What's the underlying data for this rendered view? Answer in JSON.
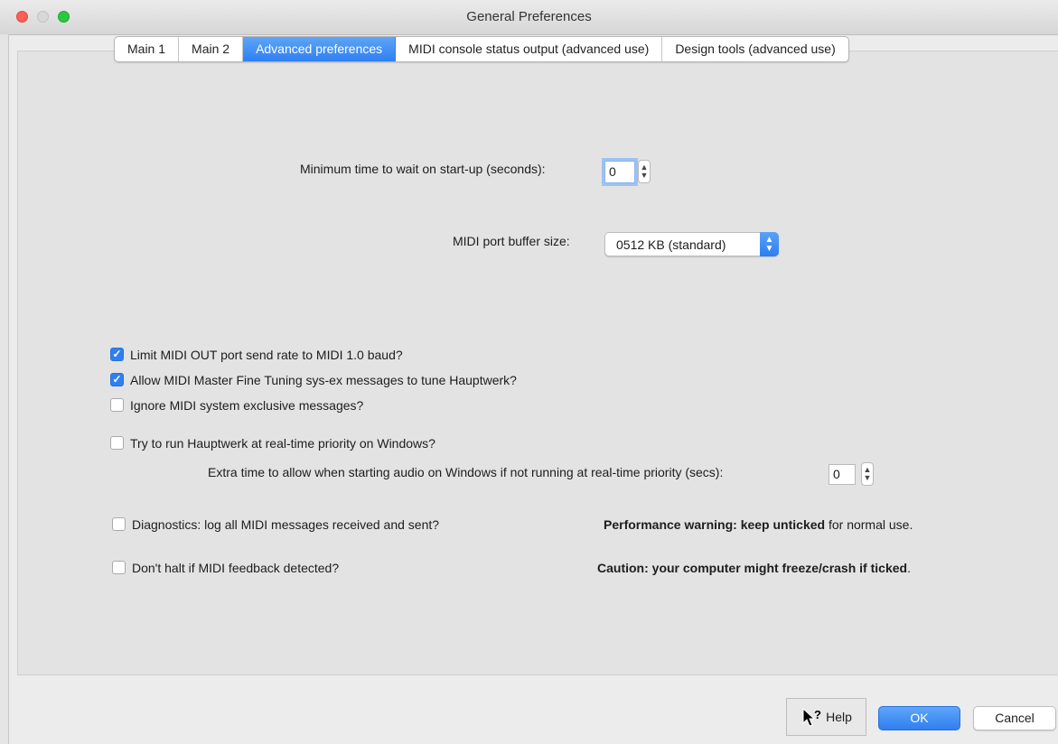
{
  "window": {
    "title": "General Preferences"
  },
  "tabs": [
    {
      "label": "Main 1",
      "active": false
    },
    {
      "label": "Main 2",
      "active": false
    },
    {
      "label": "Advanced preferences",
      "active": true
    },
    {
      "label": "MIDI console status output (advanced use)",
      "active": false
    },
    {
      "label": "Design tools (advanced use)",
      "active": false
    }
  ],
  "startup_wait": {
    "label": "Minimum time to wait on start-up (seconds):",
    "value": "0"
  },
  "buffer": {
    "label": "MIDI port buffer size:",
    "value": "0512 KB (standard)"
  },
  "options": [
    {
      "label": "Limit MIDI OUT port send rate to MIDI 1.0 baud?",
      "checked": true
    },
    {
      "label": "Allow MIDI Master Fine Tuning sys-ex messages to tune Hauptwerk?",
      "checked": true
    },
    {
      "label": "Ignore MIDI system exclusive messages?",
      "checked": false
    },
    {
      "label": "Try to run Hauptwerk at real-time priority on Windows?",
      "checked": false
    }
  ],
  "extra_time": {
    "label": "Extra time to allow when starting audio on Windows if not running at real-time priority (secs):",
    "value": "0"
  },
  "diagnostics": {
    "label": "Diagnostics: log all MIDI messages received and sent?",
    "checked": false,
    "warning_bold": "Performance warning: keep unticked",
    "warning_rest": " for normal use."
  },
  "feedback": {
    "label": "Don't halt if MIDI feedback detected?",
    "checked": false,
    "caution": "Caution: your computer might freeze/crash if ticked",
    "caution_end": "."
  },
  "buttons": {
    "help": "Help",
    "ok": "OK",
    "cancel": "Cancel"
  },
  "colors": {
    "accent": "#2f7ff1",
    "close": "#fc5f57",
    "maximize": "#28c840"
  }
}
